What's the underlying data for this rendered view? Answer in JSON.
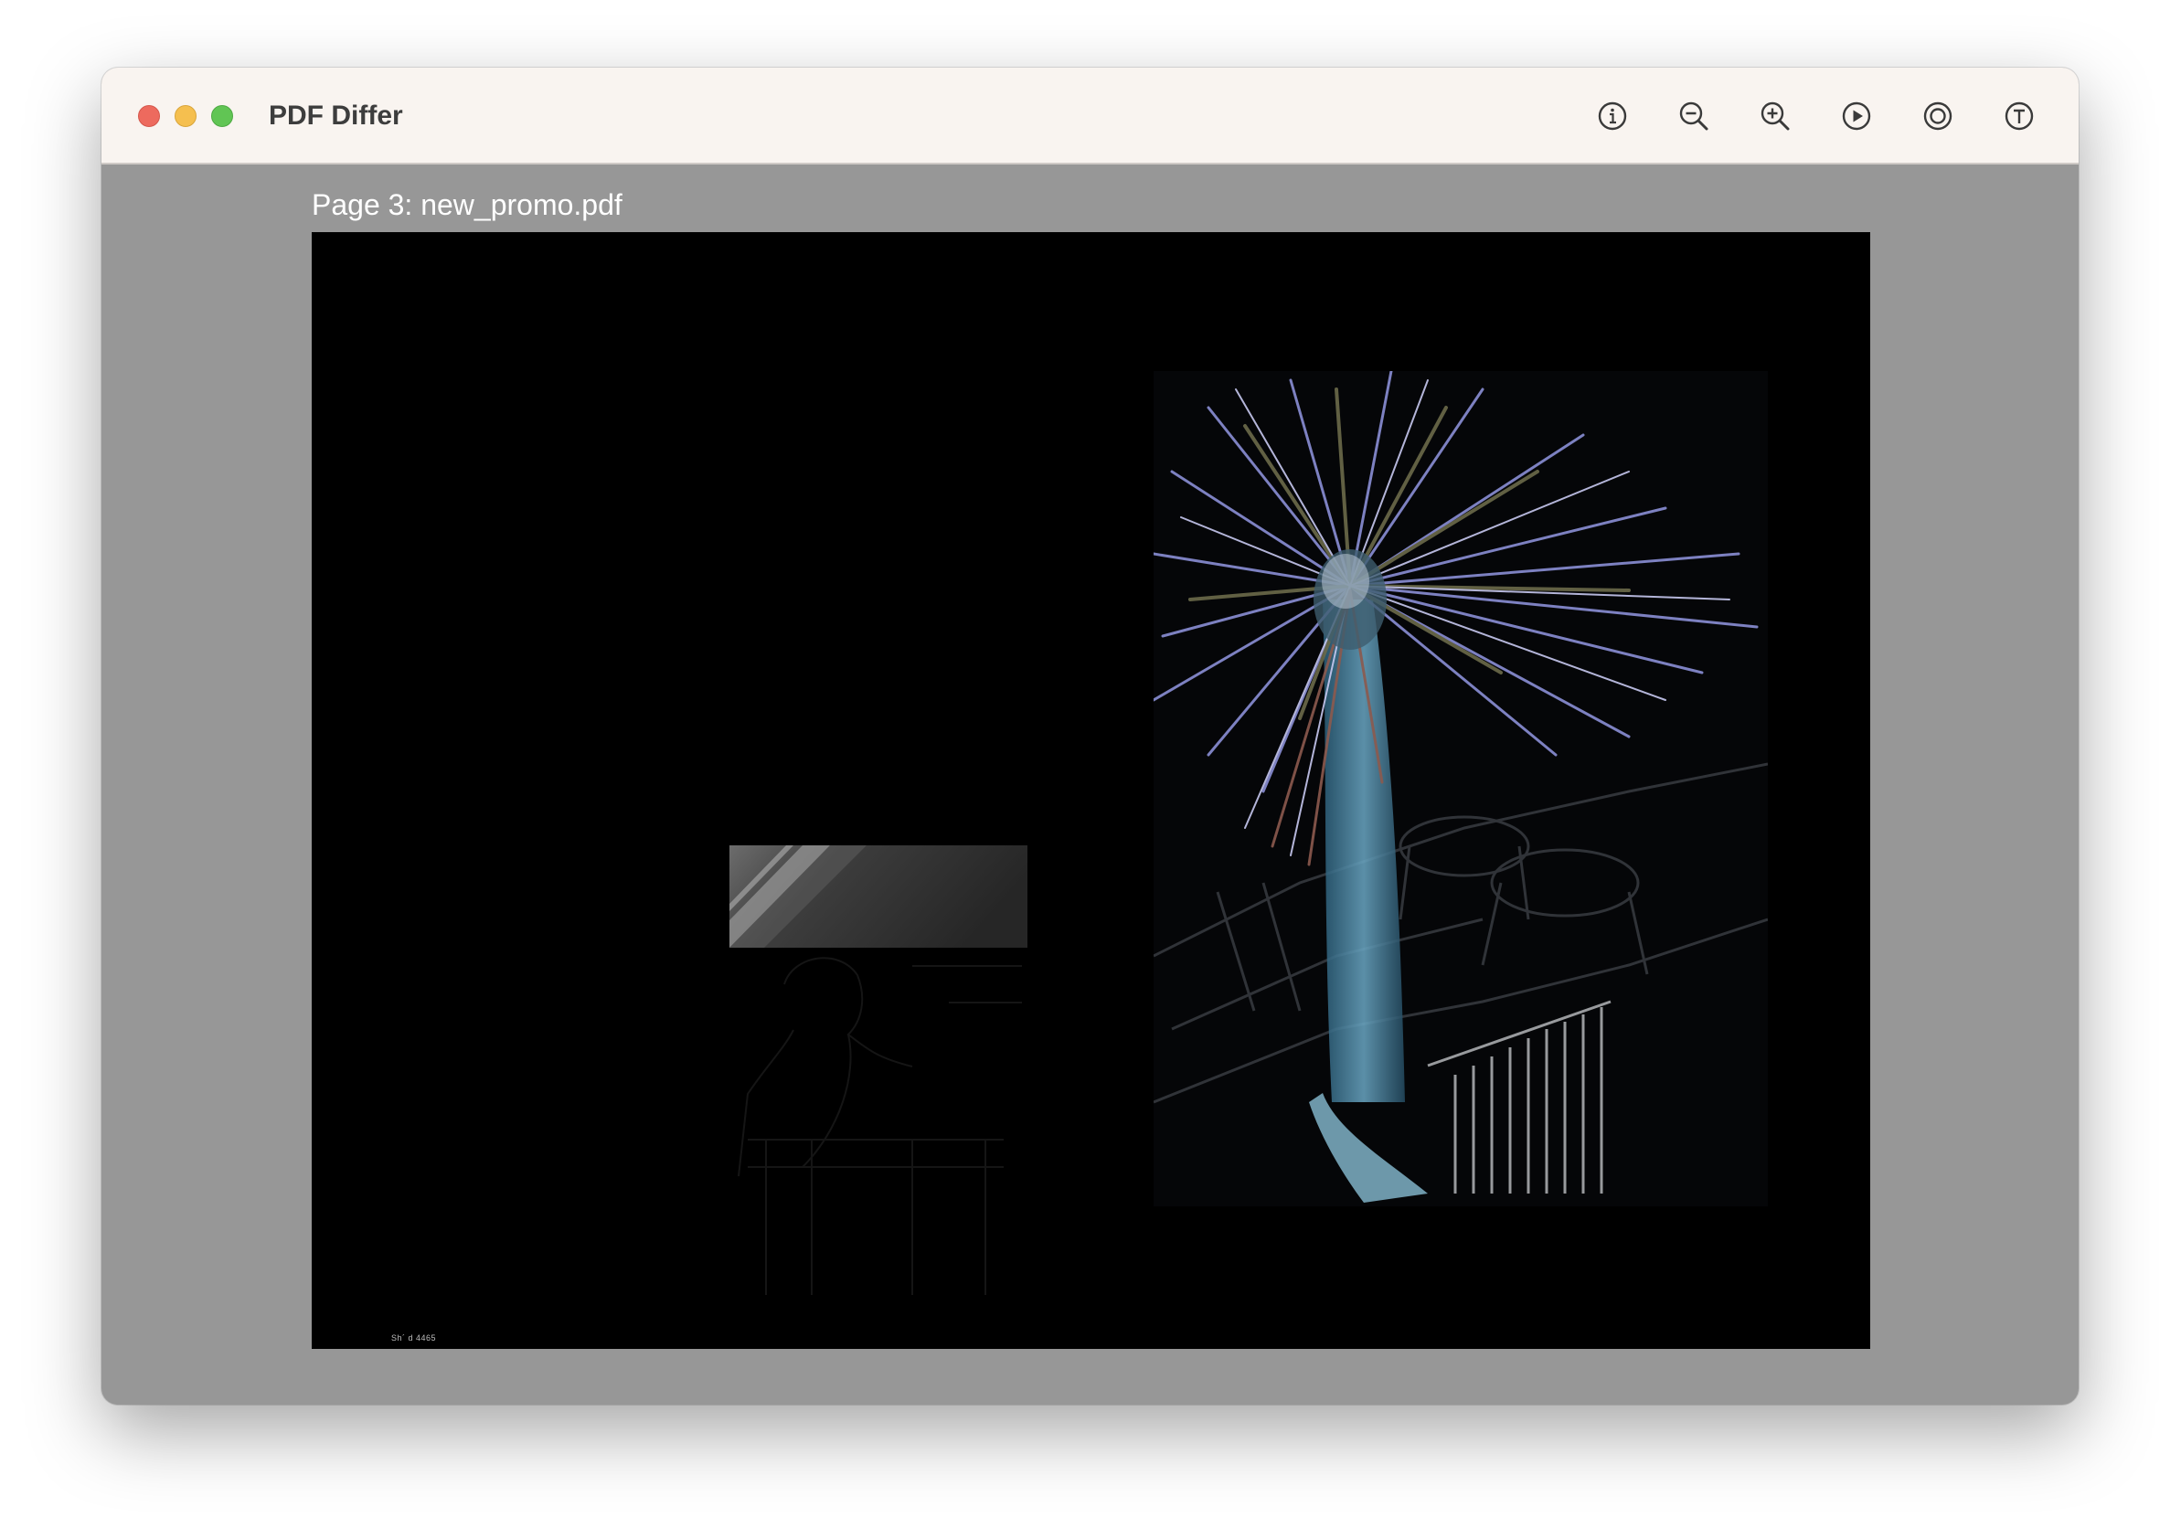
{
  "window": {
    "title": "PDF Differ",
    "controls": [
      "close",
      "minimize",
      "maximize"
    ]
  },
  "toolbar": {
    "buttons": [
      {
        "name": "info",
        "icon": "info-icon"
      },
      {
        "name": "zoom-out",
        "icon": "zoom-out-icon"
      },
      {
        "name": "zoom-in",
        "icon": "zoom-in-icon"
      },
      {
        "name": "play",
        "icon": "play-icon"
      },
      {
        "name": "circle",
        "icon": "target-icon"
      },
      {
        "name": "text",
        "icon": "text-icon"
      }
    ]
  },
  "viewer": {
    "page_label": "Page 3: new_promo.pdf",
    "footer_text": "Sh´ d 4465",
    "background_color": "#979797",
    "page_color": "#000000"
  }
}
